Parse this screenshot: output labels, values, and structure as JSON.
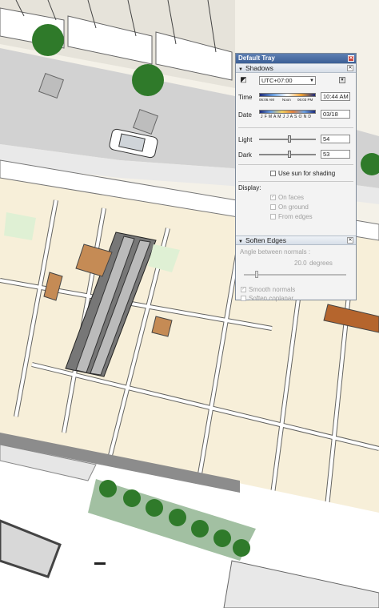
{
  "tray": {
    "title": "Default Tray",
    "shadows": {
      "header": "Shadows",
      "timezone": "UTC+07:00",
      "time_label": "Time",
      "time_min": "06:06 AM",
      "time_mid": "Noon",
      "time_max": "06:03 PM",
      "time_value": "10:44 AM",
      "date_label": "Date",
      "months": "J F M A M J J A S O N D",
      "date_value": "03/18",
      "light_label": "Light",
      "light_value": "54",
      "light_fraction": 0.54,
      "dark_label": "Dark",
      "dark_value": "53",
      "dark_fraction": 0.53,
      "use_sun_label": "Use sun for shading",
      "display_label": "Display:",
      "on_faces": "On faces",
      "on_ground": "On ground",
      "from_edges": "From edges"
    },
    "soften": {
      "header": "Soften Edges",
      "angle_label": "Angle between normals :",
      "angle_value": "20.0",
      "angle_unit": "degrees",
      "smooth_normals": "Smooth normals",
      "soften_coplanar": "Soften coplanar"
    }
  },
  "colors": {
    "title_bar": "#3b5f96",
    "floor": "#f7efd9",
    "wall": "#ffffff",
    "road": "#cfcfcf",
    "tree": "#2f7a2a"
  }
}
